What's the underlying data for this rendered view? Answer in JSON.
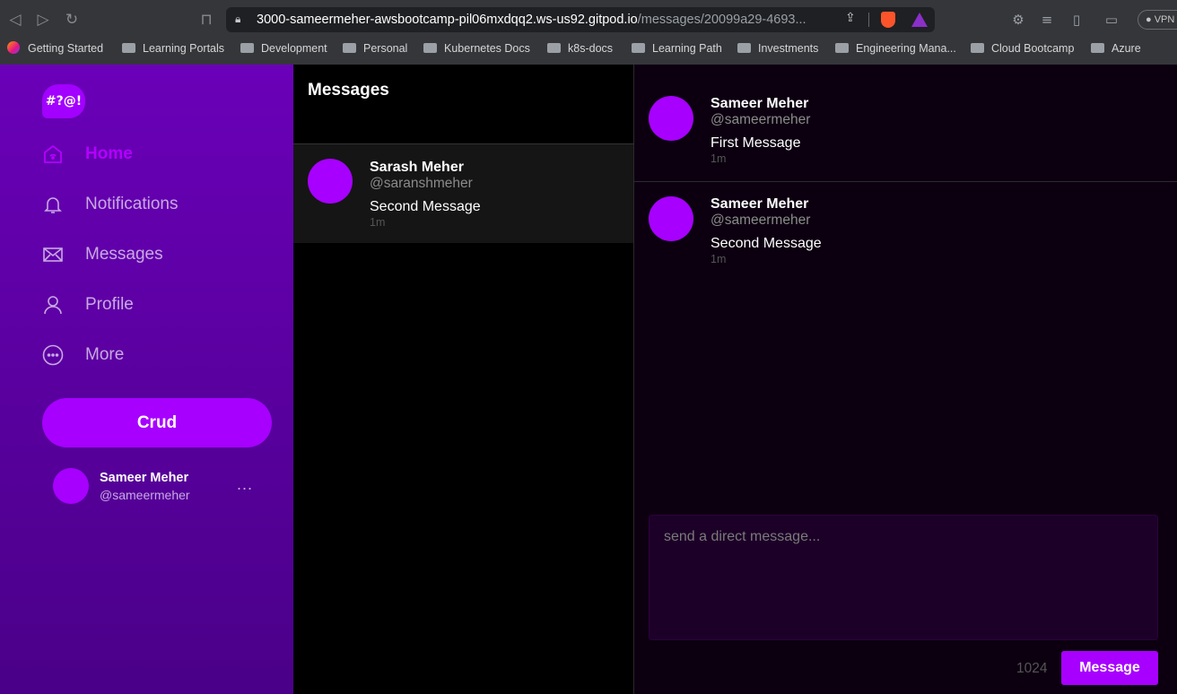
{
  "browser": {
    "url_main": "3000-sameermeher-awsbootcamp-pil06mxdqq2.ws-us92.gitpod.io",
    "url_path": "/messages/20099a29-4693...",
    "vpn_label": "VPN",
    "bookmarks": [
      "Getting Started",
      "Learning Portals",
      "Development",
      "Personal",
      "Kubernetes Docs",
      "k8s-docs",
      "Learning Path",
      "Investments",
      "Engineering Mana...",
      "Cloud Bootcamp",
      "Azure"
    ]
  },
  "sidebar": {
    "logo_text": "#?@!",
    "nav": [
      {
        "label": "Home",
        "icon": "home-icon",
        "active": true
      },
      {
        "label": "Notifications",
        "icon": "bell-icon",
        "active": false
      },
      {
        "label": "Messages",
        "icon": "envelope-icon",
        "active": false
      },
      {
        "label": "Profile",
        "icon": "user-icon",
        "active": false
      },
      {
        "label": "More",
        "icon": "more-circle-icon",
        "active": false
      }
    ],
    "crud_label": "Crud",
    "profile": {
      "name": "Sameer Meher",
      "handle": "@sameermeher",
      "more": "..."
    }
  },
  "message_groups": {
    "title": "Messages",
    "items": [
      {
        "name": "Sarash Meher",
        "handle": "@saranshmeher",
        "message": "Second Message",
        "ago": "1m"
      }
    ]
  },
  "thread": {
    "messages": [
      {
        "name": "Sameer Meher",
        "handle": "@sameermeher",
        "message": "First Message",
        "ago": "1m"
      },
      {
        "name": "Sameer Meher",
        "handle": "@sameermeher",
        "message": "Second Message",
        "ago": "1m"
      }
    ],
    "form": {
      "placeholder": "send a direct message...",
      "count": "1024",
      "send_label": "Message"
    }
  },
  "colors": {
    "accent": "#a700ff",
    "sidebar_top": "#6a00b8",
    "sidebar_bottom": "#4a0088"
  }
}
